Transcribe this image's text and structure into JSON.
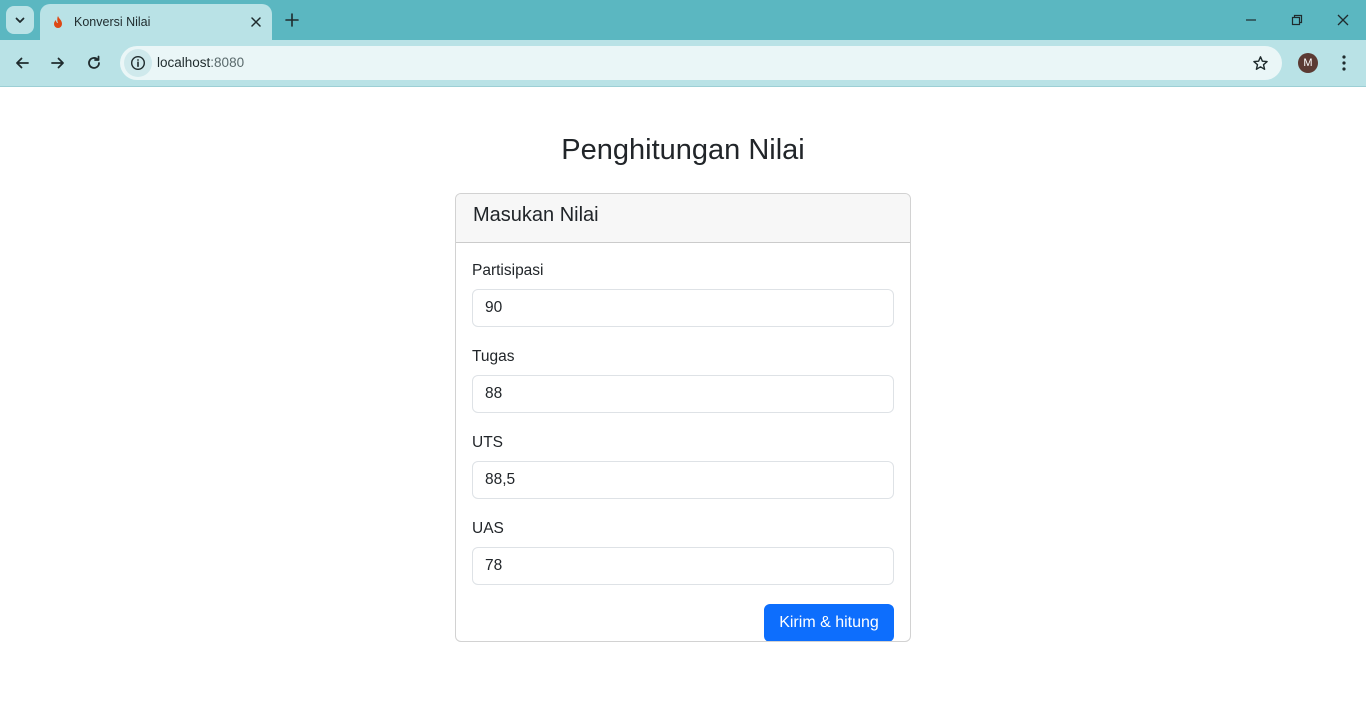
{
  "browser": {
    "tab_title": "Konversi Nilai",
    "url_host": "localhost",
    "url_port": ":8080",
    "avatar_letter": "M",
    "accent_color": "#5bb7c1",
    "toolbar_color": "#b9e2e6"
  },
  "page": {
    "title": "Penghitungan Nilai"
  },
  "form": {
    "header": "Masukan Nilai",
    "fields": [
      {
        "label": "Partisipasi",
        "value": "90"
      },
      {
        "label": "Tugas",
        "value": "88"
      },
      {
        "label": "UTS",
        "value": "88,5"
      },
      {
        "label": "UAS",
        "value": "78"
      }
    ],
    "submit_label": "Kirim & hitung",
    "submit_color": "#0d6efd"
  }
}
